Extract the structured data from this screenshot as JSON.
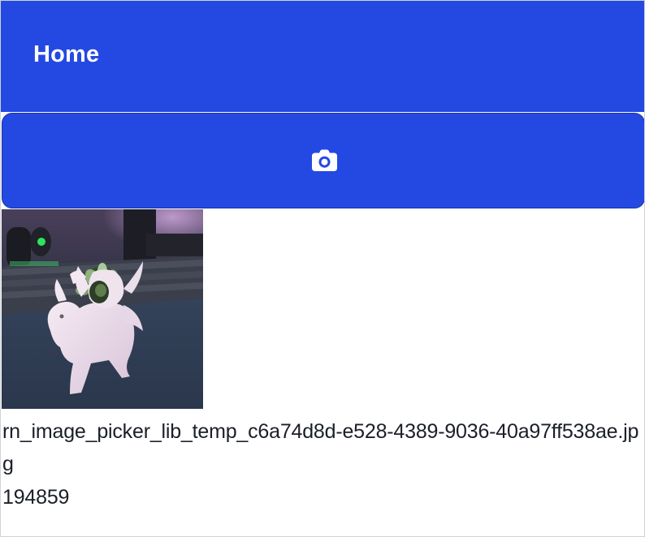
{
  "header": {
    "title": "Home",
    "background_color": "#2449e3",
    "text_color": "#ffffff"
  },
  "camera_button": {
    "icon": "camera-icon",
    "background_color": "#2449e3"
  },
  "image": {
    "file_name": "rn_image_picker_lib_temp_c6a74d8d-e528-4389-9036-40a97ff538ae.jpg",
    "file_size": "194859"
  }
}
